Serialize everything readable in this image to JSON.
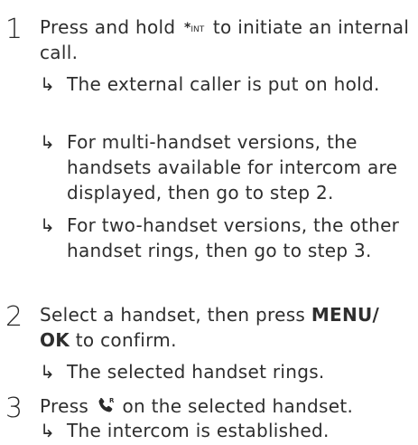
{
  "steps": [
    {
      "number": "1",
      "text_before": "Press and hold",
      "key_icon": {
        "name": "star-int-key-icon",
        "star": "*",
        "label": "INT"
      },
      "text_after": "to initiate an internal call.",
      "results": [
        "The external caller is put on hold.",
        "For multi-handset versions, the handsets available for intercom are displayed, then go to step 2.",
        "For two-handset versions, the other handset rings, then go to step 3."
      ]
    },
    {
      "number": "2",
      "text_before": "Select a handset, then press",
      "menu_label": "MENU/ OK",
      "text_after": "to confirm.",
      "results": [
        "The selected handset rings."
      ]
    },
    {
      "number": "3",
      "text_before": "Press",
      "talk_icon": {
        "name": "talk-key-icon",
        "superscript": "R"
      },
      "text_after": "on the selected handset.",
      "results": [
        "The intercom is established."
      ]
    }
  ],
  "arrow_glyph": "↳"
}
